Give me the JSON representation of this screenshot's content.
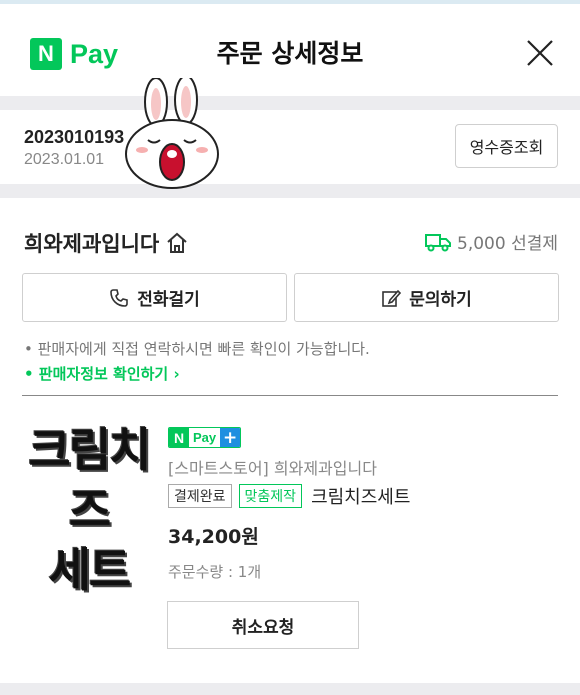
{
  "header": {
    "logo_n": "N",
    "logo_text": "Pay",
    "title": "주문 상세정보",
    "close_icon": "close-icon"
  },
  "order": {
    "order_number": "2023010193",
    "order_date": "2023.01.01",
    "receipt_button": "영수증조회"
  },
  "seller": {
    "name": "희와제과입니다",
    "home_icon": "home-icon",
    "shipping_icon": "truck-icon",
    "shipping_fee": "5,000 선결제",
    "call_button": "전화걸기",
    "inquiry_button": "문의하기",
    "note": "• 판매자에게 직접 연락하시면 빠른 확인이 가능합니다.",
    "seller_info_link": "• 판매자정보 확인하기 ›"
  },
  "product": {
    "thumbnail_lines": [
      "크림치즈",
      "세트"
    ],
    "badge_n": "N",
    "badge_text": "Pay",
    "badge_plus": "+",
    "store": "[스마트스토어] 희와제과입니다",
    "status_tag": "결제완료",
    "custom_tag": "맞춤제작",
    "name": "크림치즈세트",
    "price": "34,200원",
    "quantity": "주문수량 : 1개",
    "cancel_button": "취소요청"
  },
  "colors": {
    "accent_green": "#03c75a",
    "npay_plus_blue": "#1f8fe0",
    "divider": "#ececef"
  }
}
